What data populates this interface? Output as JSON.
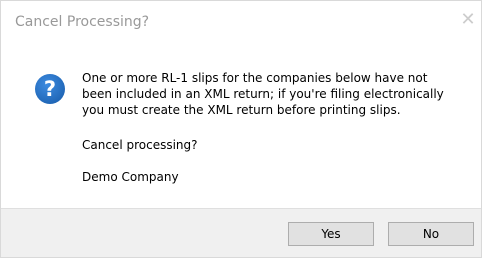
{
  "window": {
    "title": "Cancel Processing?",
    "close_glyph": "✕"
  },
  "icon": {
    "name": "question-icon",
    "glyph": "?",
    "color": "#1e64b4"
  },
  "message": {
    "lines": [
      "One or more RL-1 slips for the companies below have not",
      "been included in an XML return; if you're filing electronically",
      "you must create the XML return before printing slips."
    ],
    "prompt": "Cancel processing?",
    "company": "Demo Company"
  },
  "buttons": {
    "yes_label": "Yes",
    "no_label": "No"
  }
}
